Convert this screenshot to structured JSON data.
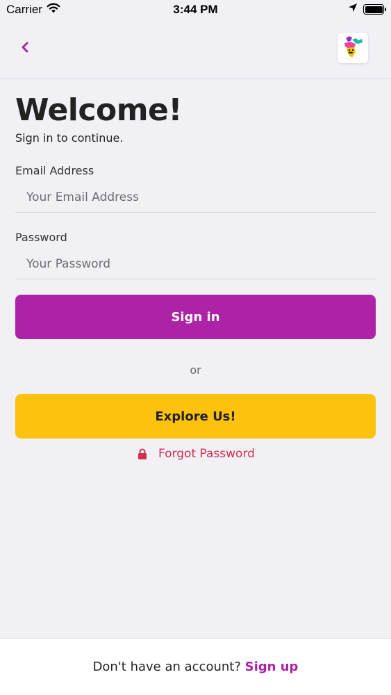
{
  "status_bar": {
    "carrier": "Carrier",
    "time": "3:44 PM"
  },
  "nav": {
    "back_icon": "chevron-left-icon",
    "logo_icon": "india-map-mascot-logo"
  },
  "login": {
    "title": "Welcome!",
    "subtitle": "Sign in to continue.",
    "email_label": "Email Address",
    "email_placeholder": "Your Email Address",
    "password_label": "Password",
    "password_placeholder": "Your Password",
    "sign_in_label": "Sign in",
    "or_text": "or",
    "explore_label": "Explore Us!",
    "forgot_label": "Forgot Password"
  },
  "footer": {
    "prompt": "Don't have an account?",
    "signup_label": "Sign up"
  },
  "colors": {
    "primary": "#ae23a5",
    "accent_yellow": "#fdc20e",
    "danger": "#d52f4e",
    "background": "#f0f0f5"
  }
}
